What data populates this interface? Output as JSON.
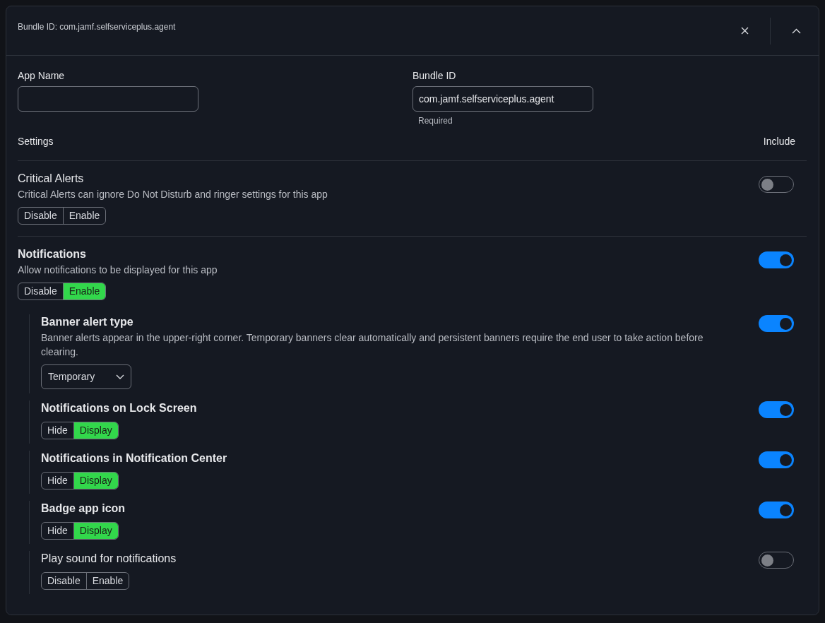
{
  "header": {
    "title": "Bundle ID: com.jamf.selfserviceplus.agent"
  },
  "fields": [
    {
      "label": "App Name"
    },
    {
      "label": "Bundle ID",
      "value": "com.jamf.selfserviceplus.agent",
      "hint": "Required"
    }
  ],
  "settings_header": {
    "label": "Settings",
    "include_label": "Include"
  },
  "settings": [
    {
      "title": "Critical Alerts",
      "description": "Critical Alerts can ignore Do Not Disturb and ringer settings for this app",
      "include": false,
      "options": [
        {
          "label": "Disable",
          "selected": false
        },
        {
          "label": "Enable",
          "selected": false
        }
      ]
    },
    {
      "title": "Notifications",
      "description": "Allow notifications to be displayed for this app",
      "include": true,
      "options": [
        {
          "label": "Disable",
          "selected": false
        },
        {
          "label": "Enable",
          "selected": true
        }
      ],
      "children": [
        {
          "title": "Banner alert type",
          "description": "Banner alerts appear in the upper-right corner. Temporary banners clear automatically and persistent banners require the end user to take action before clearing.",
          "include": true,
          "dropdown": "Temporary"
        },
        {
          "title": "Notifications on Lock Screen",
          "include": true,
          "options": [
            {
              "label": "Hide",
              "selected": false
            },
            {
              "label": "Display",
              "selected": true
            }
          ]
        },
        {
          "title": "Notifications in Notification Center",
          "include": true,
          "options": [
            {
              "label": "Hide",
              "selected": false
            },
            {
              "label": "Display",
              "selected": true
            }
          ]
        },
        {
          "title": "Badge app icon",
          "include": true,
          "options": [
            {
              "label": "Hide",
              "selected": false
            },
            {
              "label": "Display",
              "selected": true
            }
          ]
        },
        {
          "title": "Play sound for notifications",
          "include": false,
          "options": [
            {
              "label": "Disable",
              "selected": false
            },
            {
              "label": "Enable",
              "selected": false
            }
          ]
        }
      ]
    }
  ]
}
